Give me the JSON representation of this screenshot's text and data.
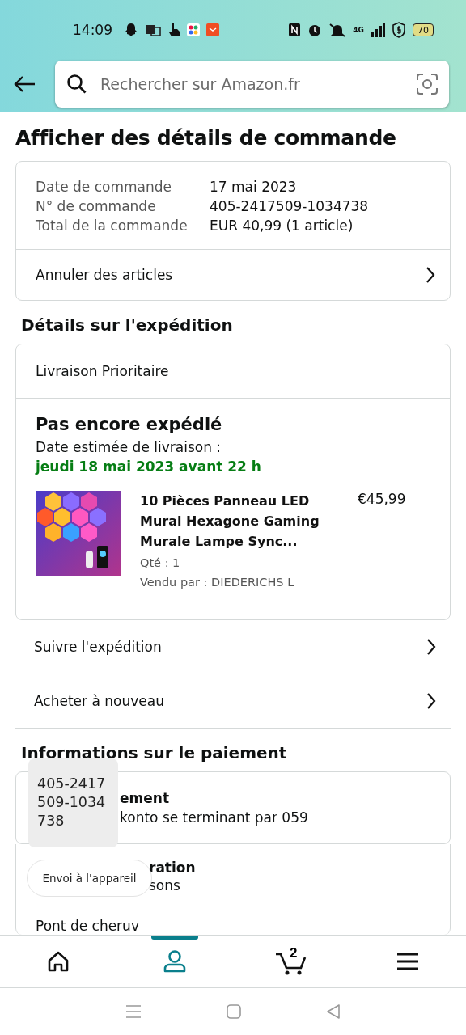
{
  "status_bar": {
    "time": "14:09",
    "network": "4G",
    "battery": "70"
  },
  "search": {
    "placeholder": "Rechercher sur Amazon.fr"
  },
  "title": "Afficher des détails de commande",
  "order_summary": {
    "rows": [
      {
        "label": "Date de commande",
        "value": "17 mai 2023"
      },
      {
        "label": "N° de commande",
        "value": "405-2417509-1034738"
      },
      {
        "label": "Total de la commande",
        "value": "EUR 40,99 (1 article)"
      }
    ],
    "action": "Annuler des articles"
  },
  "shipping": {
    "heading": "Détails sur l'expédition",
    "method": "Livraison Prioritaire",
    "status": "Pas encore expédié",
    "estimate_label": "Date estimée de livraison :",
    "estimate": "jeudi 18 mai 2023 avant 22 h",
    "item": {
      "kind": "picture",
      "title": "10 Pièces Panneau LED Mural Hexagone Gaming Murale Lampe Sync...",
      "price": "€45,99",
      "quantity": "Qté : 1",
      "seller": "Vendu par : DIEDERICHS L"
    }
  },
  "actions": [
    "Suivre l'expédition",
    "Acheter à nouveau"
  ],
  "payment": {
    "heading": "Informations sur le paiement",
    "method_title": "ement",
    "method_detail": "konto se terminant par 059",
    "section_title": "ration",
    "section_detail": "sons",
    "address_line": "Pont de cheruv"
  },
  "tooltip": "405-2417509-1034738",
  "toast": "Envoi à l'appareil",
  "nav": [
    {
      "kind": "home",
      "selected": false
    },
    {
      "kind": "account",
      "selected": true
    },
    {
      "kind": "cart",
      "badge": "2",
      "selected": false
    },
    {
      "kind": "menu",
      "selected": false
    }
  ]
}
